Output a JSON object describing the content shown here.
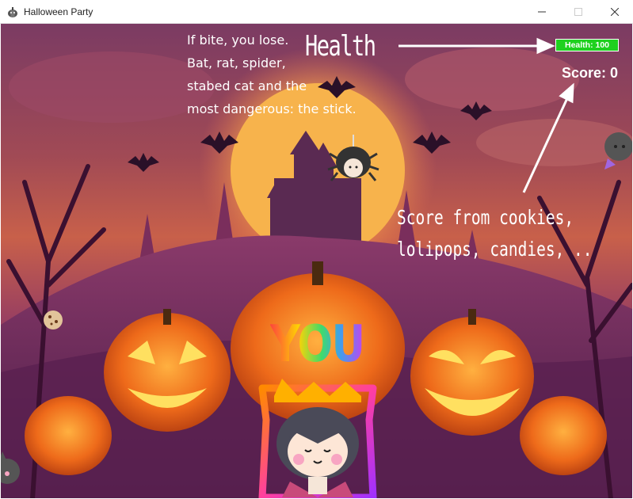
{
  "window": {
    "title": "Halloween Party",
    "icon": "pumpkin-icon",
    "controls": [
      "minimize-icon",
      "maximize-icon",
      "close-icon"
    ]
  },
  "hud": {
    "health_label": "Health: 100",
    "health_value": 100,
    "score_label": "Score: 0",
    "score_value": 0,
    "health_color": "#1fd11f"
  },
  "annotations": {
    "enemies_note": [
      "If bite, you lose.",
      "Bat, rat, spider,",
      "stabed cat and the",
      "most dangerous: the stick."
    ],
    "health_note": "Health",
    "score_note": [
      "Score from cookies,",
      "lolipops, candies, .."
    ]
  },
  "player": {
    "label": "YOU",
    "character": "vampire-player"
  },
  "sprites": [
    "spider-enemy",
    "bat-enemy",
    "cookie-pickup",
    "cat-enemy",
    "vampire-player"
  ],
  "background": {
    "scene": "haunted-castle-with-pumpkins",
    "colors": {
      "sky": "#a14a55",
      "moon": "#f7b34c",
      "pumpkin": "#e8601c",
      "glow": "#ffd24a"
    }
  }
}
